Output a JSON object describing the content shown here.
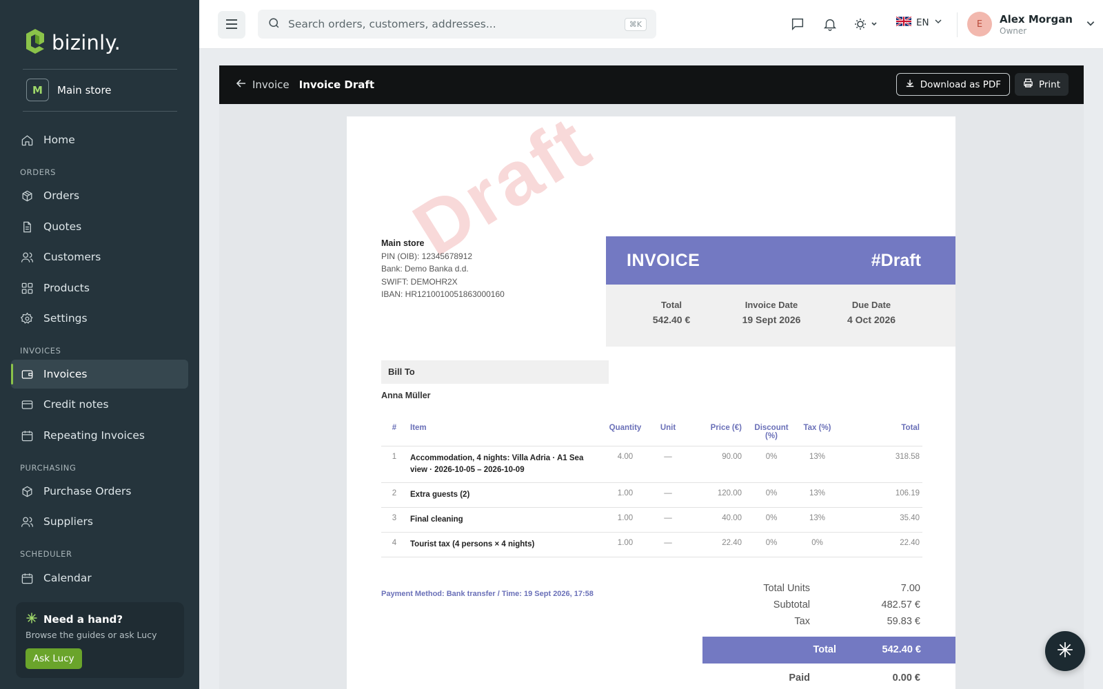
{
  "brand": {
    "name": "bizinly."
  },
  "store": {
    "initial": "M",
    "name": "Main store"
  },
  "nav": {
    "home": "Home",
    "sections": {
      "orders": "ORDERS",
      "invoices": "INVOICES",
      "purchasing": "PURCHASING",
      "scheduler": "SCHEDULER"
    },
    "orders": "Orders",
    "quotes": "Quotes",
    "customers": "Customers",
    "products": "Products",
    "settings": "Settings",
    "invoices": "Invoices",
    "credit_notes": "Credit notes",
    "repeating": "Repeating Invoices",
    "purchase_orders": "Purchase Orders",
    "suppliers": "Suppliers",
    "calendar": "Calendar",
    "active": "Invoices"
  },
  "help": {
    "title": "Need a hand?",
    "subtitle": "Browse the guides or ask Lucy",
    "button": "Ask Lucy"
  },
  "topbar": {
    "search_placeholder": "Search orders, customers, addresses...",
    "shortcut": "⌘K",
    "language": "EN",
    "user": {
      "initial": "E",
      "name": "Alex Morgan",
      "role": "Owner"
    }
  },
  "header": {
    "back_label": "Invoice",
    "title": "Invoice Draft",
    "download_label": "Download as PDF",
    "print_label": "Print"
  },
  "invoice": {
    "watermark": "Draft",
    "seller": {
      "name": "Main store",
      "pin": "PIN (OIB): 12345678912",
      "bank": "Bank: Demo Banka d.d.",
      "swift": "SWIFT: DEMOHR2X",
      "iban": "IBAN: HR1210010051863000160"
    },
    "heading": "INVOICE",
    "number": "#Draft",
    "meta": {
      "total_label": "Total",
      "total_value": "542.40 €",
      "date_label": "Invoice Date",
      "date_value": "19 Sept 2026",
      "due_label": "Due Date",
      "due_value": "4 Oct 2026"
    },
    "bill_to_label": "Bill To",
    "customer": "Anna Müller",
    "columns": {
      "num": "#",
      "item": "Item",
      "qty": "Quantity",
      "unit": "Unit",
      "price": "Price (€)",
      "discount": "Discount (%)",
      "tax": "Tax (%)",
      "total": "Total"
    },
    "rows": [
      {
        "num": "1",
        "item": "Accommodation, 4 nights: Villa Adria · A1 Sea view · 2026-10-05 – 2026-10-09",
        "qty": "4.00",
        "unit": "—",
        "price": "90.00",
        "discount": "0%",
        "tax": "13%",
        "total": "318.58"
      },
      {
        "num": "2",
        "item": "Extra guests (2)",
        "qty": "1.00",
        "unit": "—",
        "price": "120.00",
        "discount": "0%",
        "tax": "13%",
        "total": "106.19"
      },
      {
        "num": "3",
        "item": "Final cleaning",
        "qty": "1.00",
        "unit": "—",
        "price": "40.00",
        "discount": "0%",
        "tax": "13%",
        "total": "35.40"
      },
      {
        "num": "4",
        "item": "Tourist tax (4 persons × 4 nights)",
        "qty": "1.00",
        "unit": "—",
        "price": "22.40",
        "discount": "0%",
        "tax": "0%",
        "total": "22.40"
      }
    ],
    "payment_line": "Payment Method: Bank transfer  / Time: 19 Sept 2026, 17:58",
    "totals": {
      "units_label": "Total Units",
      "units_value": "7.00",
      "subtotal_label": "Subtotal",
      "subtotal_value": "482.57 €",
      "tax_label": "Tax",
      "tax_value": "59.83 €",
      "total_label": "Total",
      "total_value": "542.40 €",
      "paid_label": "Paid",
      "paid_value": "0.00 €"
    }
  },
  "colors": {
    "accent_green": "#8bc34a",
    "invoice_purple": "#7379c2",
    "sidebar_bg": "#25343c"
  }
}
